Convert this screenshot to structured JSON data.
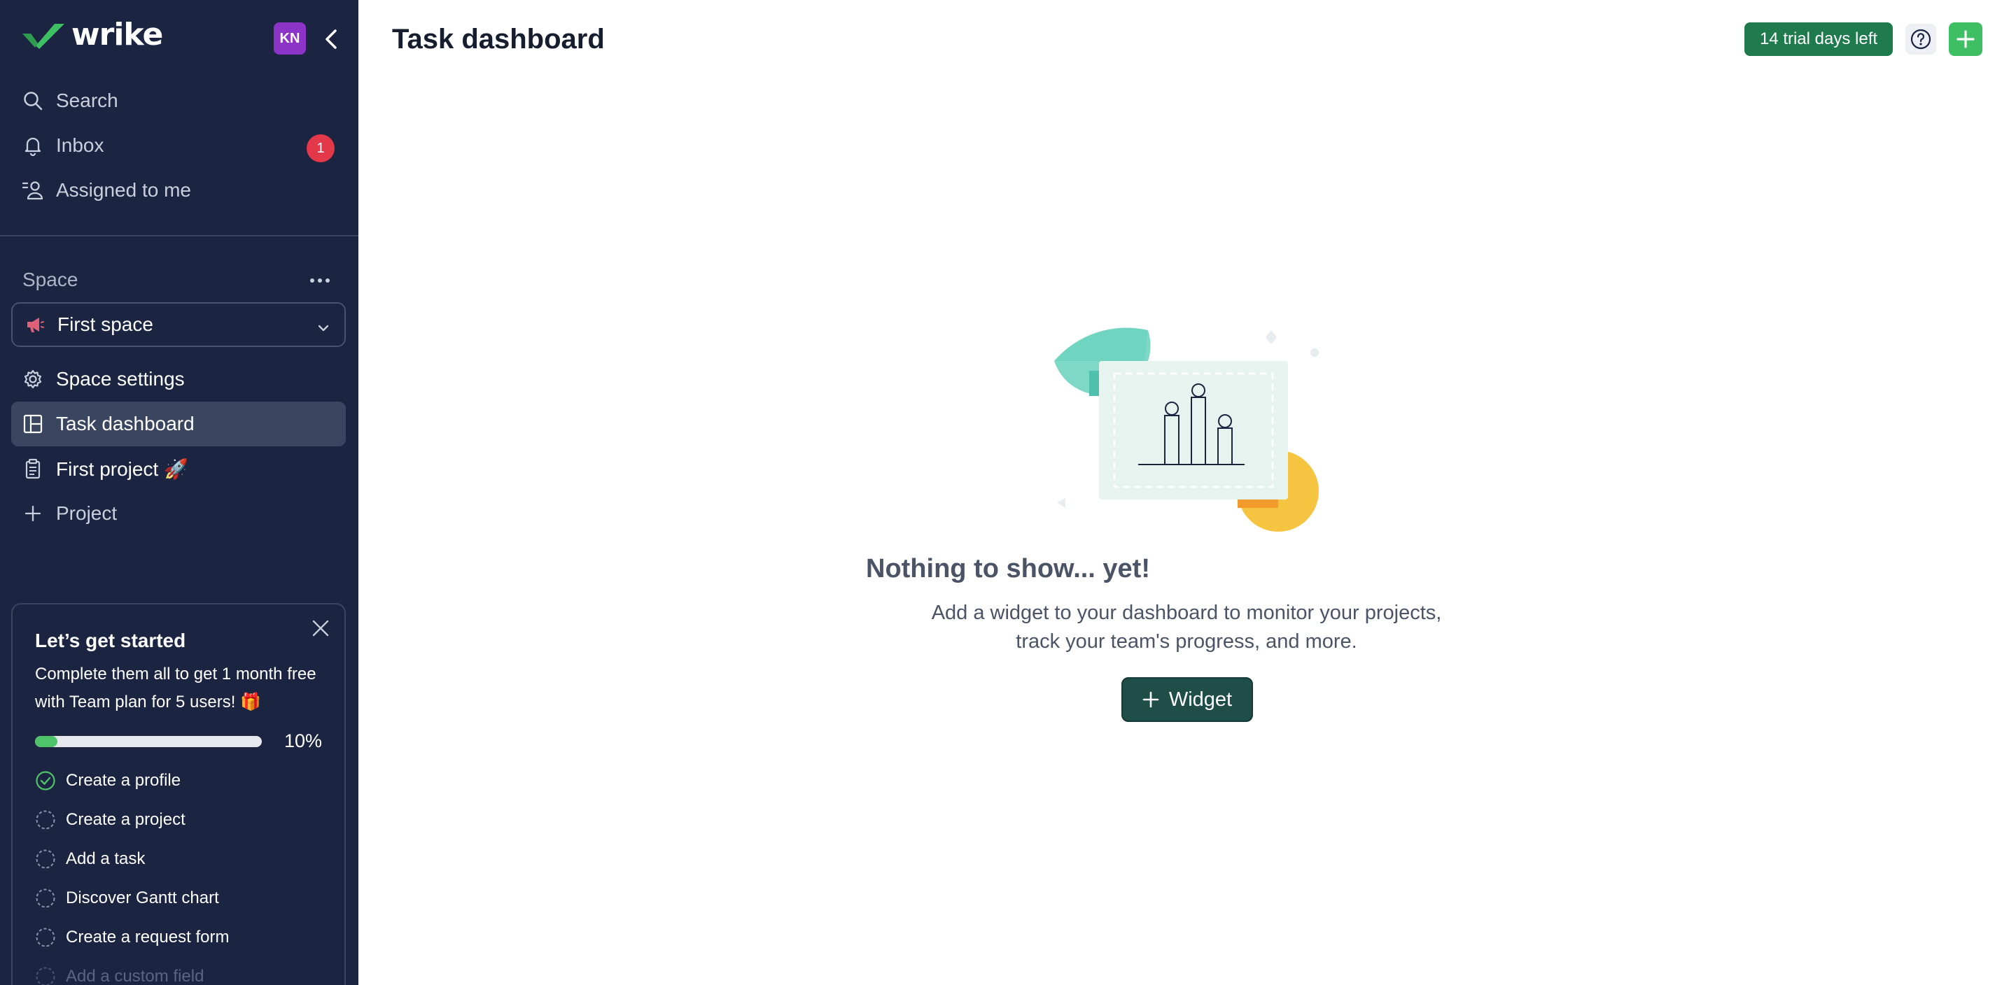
{
  "brand": {
    "name": "wrike",
    "logo_icon": "wrike-check-logo"
  },
  "user": {
    "initials": "KN",
    "avatar_color": "#8b34c7"
  },
  "nav": {
    "search": "Search",
    "inbox": "Inbox",
    "inbox_count": "1",
    "assigned": "Assigned to me"
  },
  "space": {
    "label": "Space",
    "selected": "First space",
    "items": [
      {
        "label": "Space settings",
        "icon": "gear-icon"
      },
      {
        "label": "Task dashboard",
        "icon": "dashboard-icon"
      },
      {
        "label": "First project 🚀",
        "icon": "clipboard-icon"
      },
      {
        "label": "Project",
        "icon": "plus-icon"
      }
    ]
  },
  "onboarding": {
    "title": "Let’s get started",
    "text": "Complete them all to get 1 month free with Team plan for 5 users! 🎁",
    "progress_percent": 10,
    "progress_label": "10%",
    "tasks": [
      {
        "label": "Create a profile",
        "done": true
      },
      {
        "label": "Create a project",
        "done": false
      },
      {
        "label": "Add a task",
        "done": false
      },
      {
        "label": "Discover Gantt chart",
        "done": false
      },
      {
        "label": "Create a request form",
        "done": false
      },
      {
        "label": "Add a custom field",
        "done": false
      }
    ]
  },
  "header": {
    "title": "Task dashboard",
    "trial": "14 trial days left"
  },
  "empty_state": {
    "title": "Nothing to show... yet!",
    "line1": "Add a widget to your dashboard to monitor your projects,",
    "line2": "track your team's progress, and more.",
    "button": "Widget"
  },
  "colors": {
    "sidebar_bg": "#1b2440",
    "active_item": "#3a4560",
    "trial_badge": "#1f7a4e",
    "add_button": "#3fbf63",
    "widget_button": "#1f4d47",
    "inbox_badge": "#e2384a",
    "progress": "#4fc36a"
  }
}
